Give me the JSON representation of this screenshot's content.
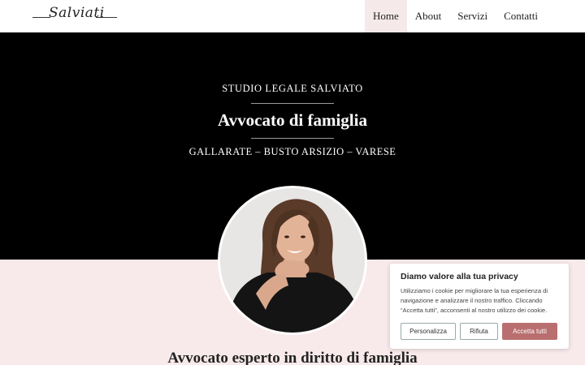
{
  "header": {
    "logo_text": "Salviati",
    "nav": [
      {
        "label": "Home",
        "active": true
      },
      {
        "label": "About",
        "active": false
      },
      {
        "label": "Servizi",
        "active": false
      },
      {
        "label": "Contatti",
        "active": false
      }
    ]
  },
  "hero": {
    "subtitle": "STUDIO LEGALE SALVIATO",
    "title": "Avvocato di famiglia",
    "locations": "GALLARATE – BUSTO ARSIZIO – VARESE"
  },
  "section": {
    "title": "Avvocato esperto in diritto di famiglia"
  },
  "cookie": {
    "title": "Diamo valore alla tua privacy",
    "text": "Utilizziamo i cookie per migliorare la tua esperienza di navigazione e analizzare il nostro traffico. Cliccando “Accetta tutti”, acconsenti al nostro utilizzo dei cookie.",
    "customize_label": "Personalizza",
    "reject_label": "Rifiuta",
    "accept_label": "Accetta tutti"
  },
  "colors": {
    "hero_bg": "#000000",
    "band_bg": "#f8eaeb",
    "nav_active_bg": "#f6e9ea",
    "accent": "#b96f6f"
  }
}
